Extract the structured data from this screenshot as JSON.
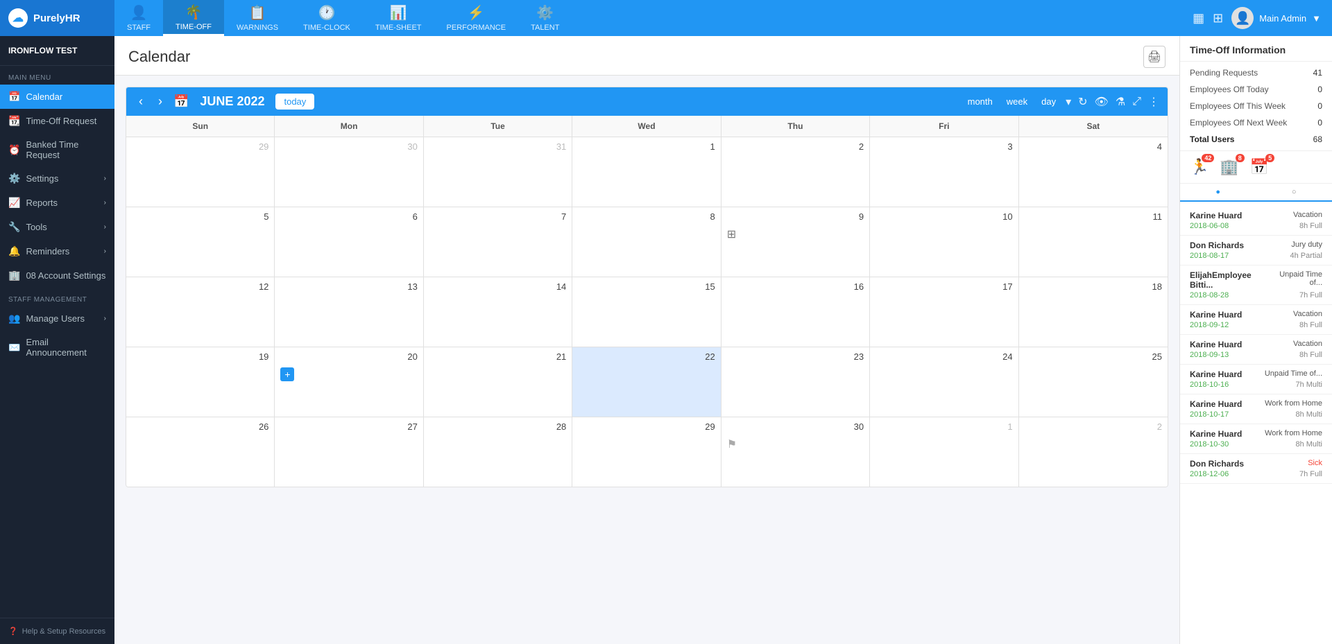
{
  "app": {
    "logo_text": "PurelyHR",
    "org_name": "IRONFLOW TEST"
  },
  "top_nav": {
    "items": [
      {
        "id": "staff",
        "label": "STAFF",
        "icon": "👤",
        "active": false
      },
      {
        "id": "time-off",
        "label": "TIME-OFF",
        "icon": "🌴",
        "active": true
      },
      {
        "id": "warnings",
        "label": "WARNINGS",
        "icon": "📋",
        "active": false
      },
      {
        "id": "time-clock",
        "label": "TIME-CLOCK",
        "icon": "🕐",
        "active": false
      },
      {
        "id": "time-sheet",
        "label": "TIME-SHEET",
        "icon": "📊",
        "active": false
      },
      {
        "id": "performance",
        "label": "PERFORMANCE",
        "icon": "⚡",
        "active": false
      },
      {
        "id": "talent",
        "label": "TALENT",
        "icon": "⚙️",
        "active": false
      }
    ],
    "user_name": "Main Admin"
  },
  "sidebar": {
    "section_main": "MAIN MENU",
    "section_staff": "STAFF MANAGEMENT",
    "items_main": [
      {
        "id": "calendar",
        "label": "Calendar",
        "icon": "📅",
        "active": true,
        "has_arrow": false
      },
      {
        "id": "time-off-request",
        "label": "Time-Off Request",
        "icon": "📆",
        "active": false,
        "has_arrow": false
      },
      {
        "id": "banked-time",
        "label": "Banked Time Request",
        "icon": "⏰",
        "active": false,
        "has_arrow": false
      },
      {
        "id": "settings",
        "label": "Settings",
        "icon": "⚙️",
        "active": false,
        "has_arrow": true
      },
      {
        "id": "reports",
        "label": "Reports",
        "icon": "📈",
        "active": false,
        "has_arrow": true
      },
      {
        "id": "tools",
        "label": "Tools",
        "icon": "🔧",
        "active": false,
        "has_arrow": true
      },
      {
        "id": "reminders",
        "label": "Reminders",
        "icon": "🔔",
        "active": false,
        "has_arrow": true
      },
      {
        "id": "account-settings",
        "label": "08 Account Settings",
        "icon": "🏢",
        "active": false,
        "has_arrow": false
      }
    ],
    "items_staff": [
      {
        "id": "manage-users",
        "label": "Manage Users",
        "icon": "👥",
        "active": false,
        "has_arrow": true
      },
      {
        "id": "email-announcement",
        "label": "Email Announcement",
        "icon": "✉️",
        "active": false,
        "has_arrow": false
      }
    ],
    "footer_text": "Help & Setup Resources"
  },
  "content": {
    "title": "Calendar",
    "calendar": {
      "month_label": "JUNE 2022",
      "view_today": "today",
      "view_month": "month",
      "view_week": "week",
      "view_day": "day",
      "day_headers": [
        "Sun",
        "Mon",
        "Tue",
        "Wed",
        "Thu",
        "Fri",
        "Sat"
      ],
      "weeks": [
        [
          {
            "date": "29",
            "other": true,
            "today": false,
            "selected": false,
            "has_add": false,
            "has_event": false,
            "has_flag": false
          },
          {
            "date": "30",
            "other": true,
            "today": false,
            "selected": false,
            "has_add": false,
            "has_event": false,
            "has_flag": false
          },
          {
            "date": "31",
            "other": true,
            "today": false,
            "selected": false,
            "has_add": false,
            "has_event": false,
            "has_flag": false
          },
          {
            "date": "1",
            "other": false,
            "today": false,
            "selected": false,
            "has_add": false,
            "has_event": false,
            "has_flag": false
          },
          {
            "date": "2",
            "other": false,
            "today": false,
            "selected": false,
            "has_add": false,
            "has_event": false,
            "has_flag": false
          },
          {
            "date": "3",
            "other": false,
            "today": false,
            "selected": false,
            "has_add": false,
            "has_event": false,
            "has_flag": false
          },
          {
            "date": "4",
            "other": false,
            "today": false,
            "selected": false,
            "has_add": false,
            "has_event": false,
            "has_flag": false
          }
        ],
        [
          {
            "date": "5",
            "other": false,
            "today": false,
            "selected": false,
            "has_add": false,
            "has_event": false,
            "has_flag": false
          },
          {
            "date": "6",
            "other": false,
            "today": false,
            "selected": false,
            "has_add": false,
            "has_event": false,
            "has_flag": false
          },
          {
            "date": "7",
            "other": false,
            "today": false,
            "selected": false,
            "has_add": false,
            "has_event": false,
            "has_flag": false
          },
          {
            "date": "8",
            "other": false,
            "today": false,
            "selected": false,
            "has_add": false,
            "has_event": false,
            "has_flag": false
          },
          {
            "date": "9",
            "other": false,
            "today": false,
            "selected": false,
            "has_add": false,
            "has_event": true,
            "has_flag": false
          },
          {
            "date": "10",
            "other": false,
            "today": false,
            "selected": false,
            "has_add": false,
            "has_event": false,
            "has_flag": false
          },
          {
            "date": "11",
            "other": false,
            "today": false,
            "selected": false,
            "has_add": false,
            "has_event": false,
            "has_flag": false
          }
        ],
        [
          {
            "date": "12",
            "other": false,
            "today": false,
            "selected": false,
            "has_add": false,
            "has_event": false,
            "has_flag": false
          },
          {
            "date": "13",
            "other": false,
            "today": false,
            "selected": false,
            "has_add": false,
            "has_event": false,
            "has_flag": false
          },
          {
            "date": "14",
            "other": false,
            "today": false,
            "selected": false,
            "has_add": false,
            "has_event": false,
            "has_flag": false
          },
          {
            "date": "15",
            "other": false,
            "today": false,
            "selected": false,
            "has_add": false,
            "has_event": false,
            "has_flag": false
          },
          {
            "date": "16",
            "other": false,
            "today": false,
            "selected": false,
            "has_add": false,
            "has_event": false,
            "has_flag": false
          },
          {
            "date": "17",
            "other": false,
            "today": false,
            "selected": false,
            "has_add": false,
            "has_event": false,
            "has_flag": false
          },
          {
            "date": "18",
            "other": false,
            "today": false,
            "selected": false,
            "has_add": false,
            "has_event": false,
            "has_flag": false
          }
        ],
        [
          {
            "date": "19",
            "other": false,
            "today": false,
            "selected": false,
            "has_add": false,
            "has_event": false,
            "has_flag": false
          },
          {
            "date": "20",
            "other": false,
            "today": false,
            "selected": false,
            "has_add": true,
            "has_event": false,
            "has_flag": false
          },
          {
            "date": "21",
            "other": false,
            "today": false,
            "selected": false,
            "has_add": false,
            "has_event": false,
            "has_flag": false
          },
          {
            "date": "22",
            "other": false,
            "today": false,
            "selected": true,
            "has_add": false,
            "has_event": false,
            "has_flag": false
          },
          {
            "date": "23",
            "other": false,
            "today": false,
            "selected": false,
            "has_add": false,
            "has_event": false,
            "has_flag": false
          },
          {
            "date": "24",
            "other": false,
            "today": false,
            "selected": false,
            "has_add": false,
            "has_event": false,
            "has_flag": false
          },
          {
            "date": "25",
            "other": false,
            "today": false,
            "selected": false,
            "has_add": false,
            "has_event": false,
            "has_flag": false
          }
        ],
        [
          {
            "date": "26",
            "other": false,
            "today": false,
            "selected": false,
            "has_add": false,
            "has_event": false,
            "has_flag": false
          },
          {
            "date": "27",
            "other": false,
            "today": false,
            "selected": false,
            "has_add": false,
            "has_event": false,
            "has_flag": false
          },
          {
            "date": "28",
            "other": false,
            "today": false,
            "selected": false,
            "has_add": false,
            "has_event": false,
            "has_flag": false
          },
          {
            "date": "29",
            "other": false,
            "today": false,
            "selected": false,
            "has_add": false,
            "has_event": false,
            "has_flag": false
          },
          {
            "date": "30",
            "other": false,
            "today": false,
            "selected": false,
            "has_add": false,
            "has_event": false,
            "has_flag": true
          },
          {
            "date": "1",
            "other": true,
            "today": false,
            "selected": false,
            "has_add": false,
            "has_event": false,
            "has_flag": false
          },
          {
            "date": "2",
            "other": true,
            "today": false,
            "selected": false,
            "has_add": false,
            "has_event": false,
            "has_flag": false
          }
        ]
      ]
    }
  },
  "right_panel": {
    "header": "Time-Off Information",
    "stats": [
      {
        "label": "Pending Requests",
        "value": "41"
      },
      {
        "label": "Employees Off Today",
        "value": "0"
      },
      {
        "label": "Employees Off This Week",
        "value": "0"
      },
      {
        "label": "Employees Off Next Week",
        "value": "0"
      }
    ],
    "total_users_label": "Total Users",
    "total_users_value": "68",
    "icon_badges": [
      {
        "icon": "🏃",
        "badge": "42",
        "color": "#f44336"
      },
      {
        "icon": "🏢",
        "badge": "8",
        "color": "#f44336"
      },
      {
        "icon": "📅",
        "badge": "5",
        "color": "#f44336"
      }
    ],
    "requests": [
      {
        "name": "Karine Huard",
        "type": "Vacation",
        "date": "2018-06-08",
        "hours": "8h Full"
      },
      {
        "name": "Don Richards",
        "type": "Jury duty",
        "date": "2018-08-17",
        "hours": "4h Partial"
      },
      {
        "name": "ElijahEmployee Bitti...",
        "type": "Unpaid Time of...",
        "date": "2018-08-28",
        "hours": "7h Full"
      },
      {
        "name": "Karine Huard",
        "type": "Vacation",
        "date": "2018-09-12",
        "hours": "8h Full"
      },
      {
        "name": "Karine Huard",
        "type": "Vacation",
        "date": "2018-09-13",
        "hours": "8h Full"
      },
      {
        "name": "Karine Huard",
        "type": "Unpaid Time of...",
        "date": "2018-10-16",
        "hours": "7h Multi"
      },
      {
        "name": "Karine Huard",
        "type": "Work from Home",
        "date": "2018-10-17",
        "hours": "8h Multi"
      },
      {
        "name": "Karine Huard",
        "type": "Work from Home",
        "date": "2018-10-30",
        "hours": "8h Multi"
      },
      {
        "name": "Don Richards",
        "type": "Sick",
        "date": "2018-12-06",
        "hours": "7h Full"
      }
    ]
  }
}
